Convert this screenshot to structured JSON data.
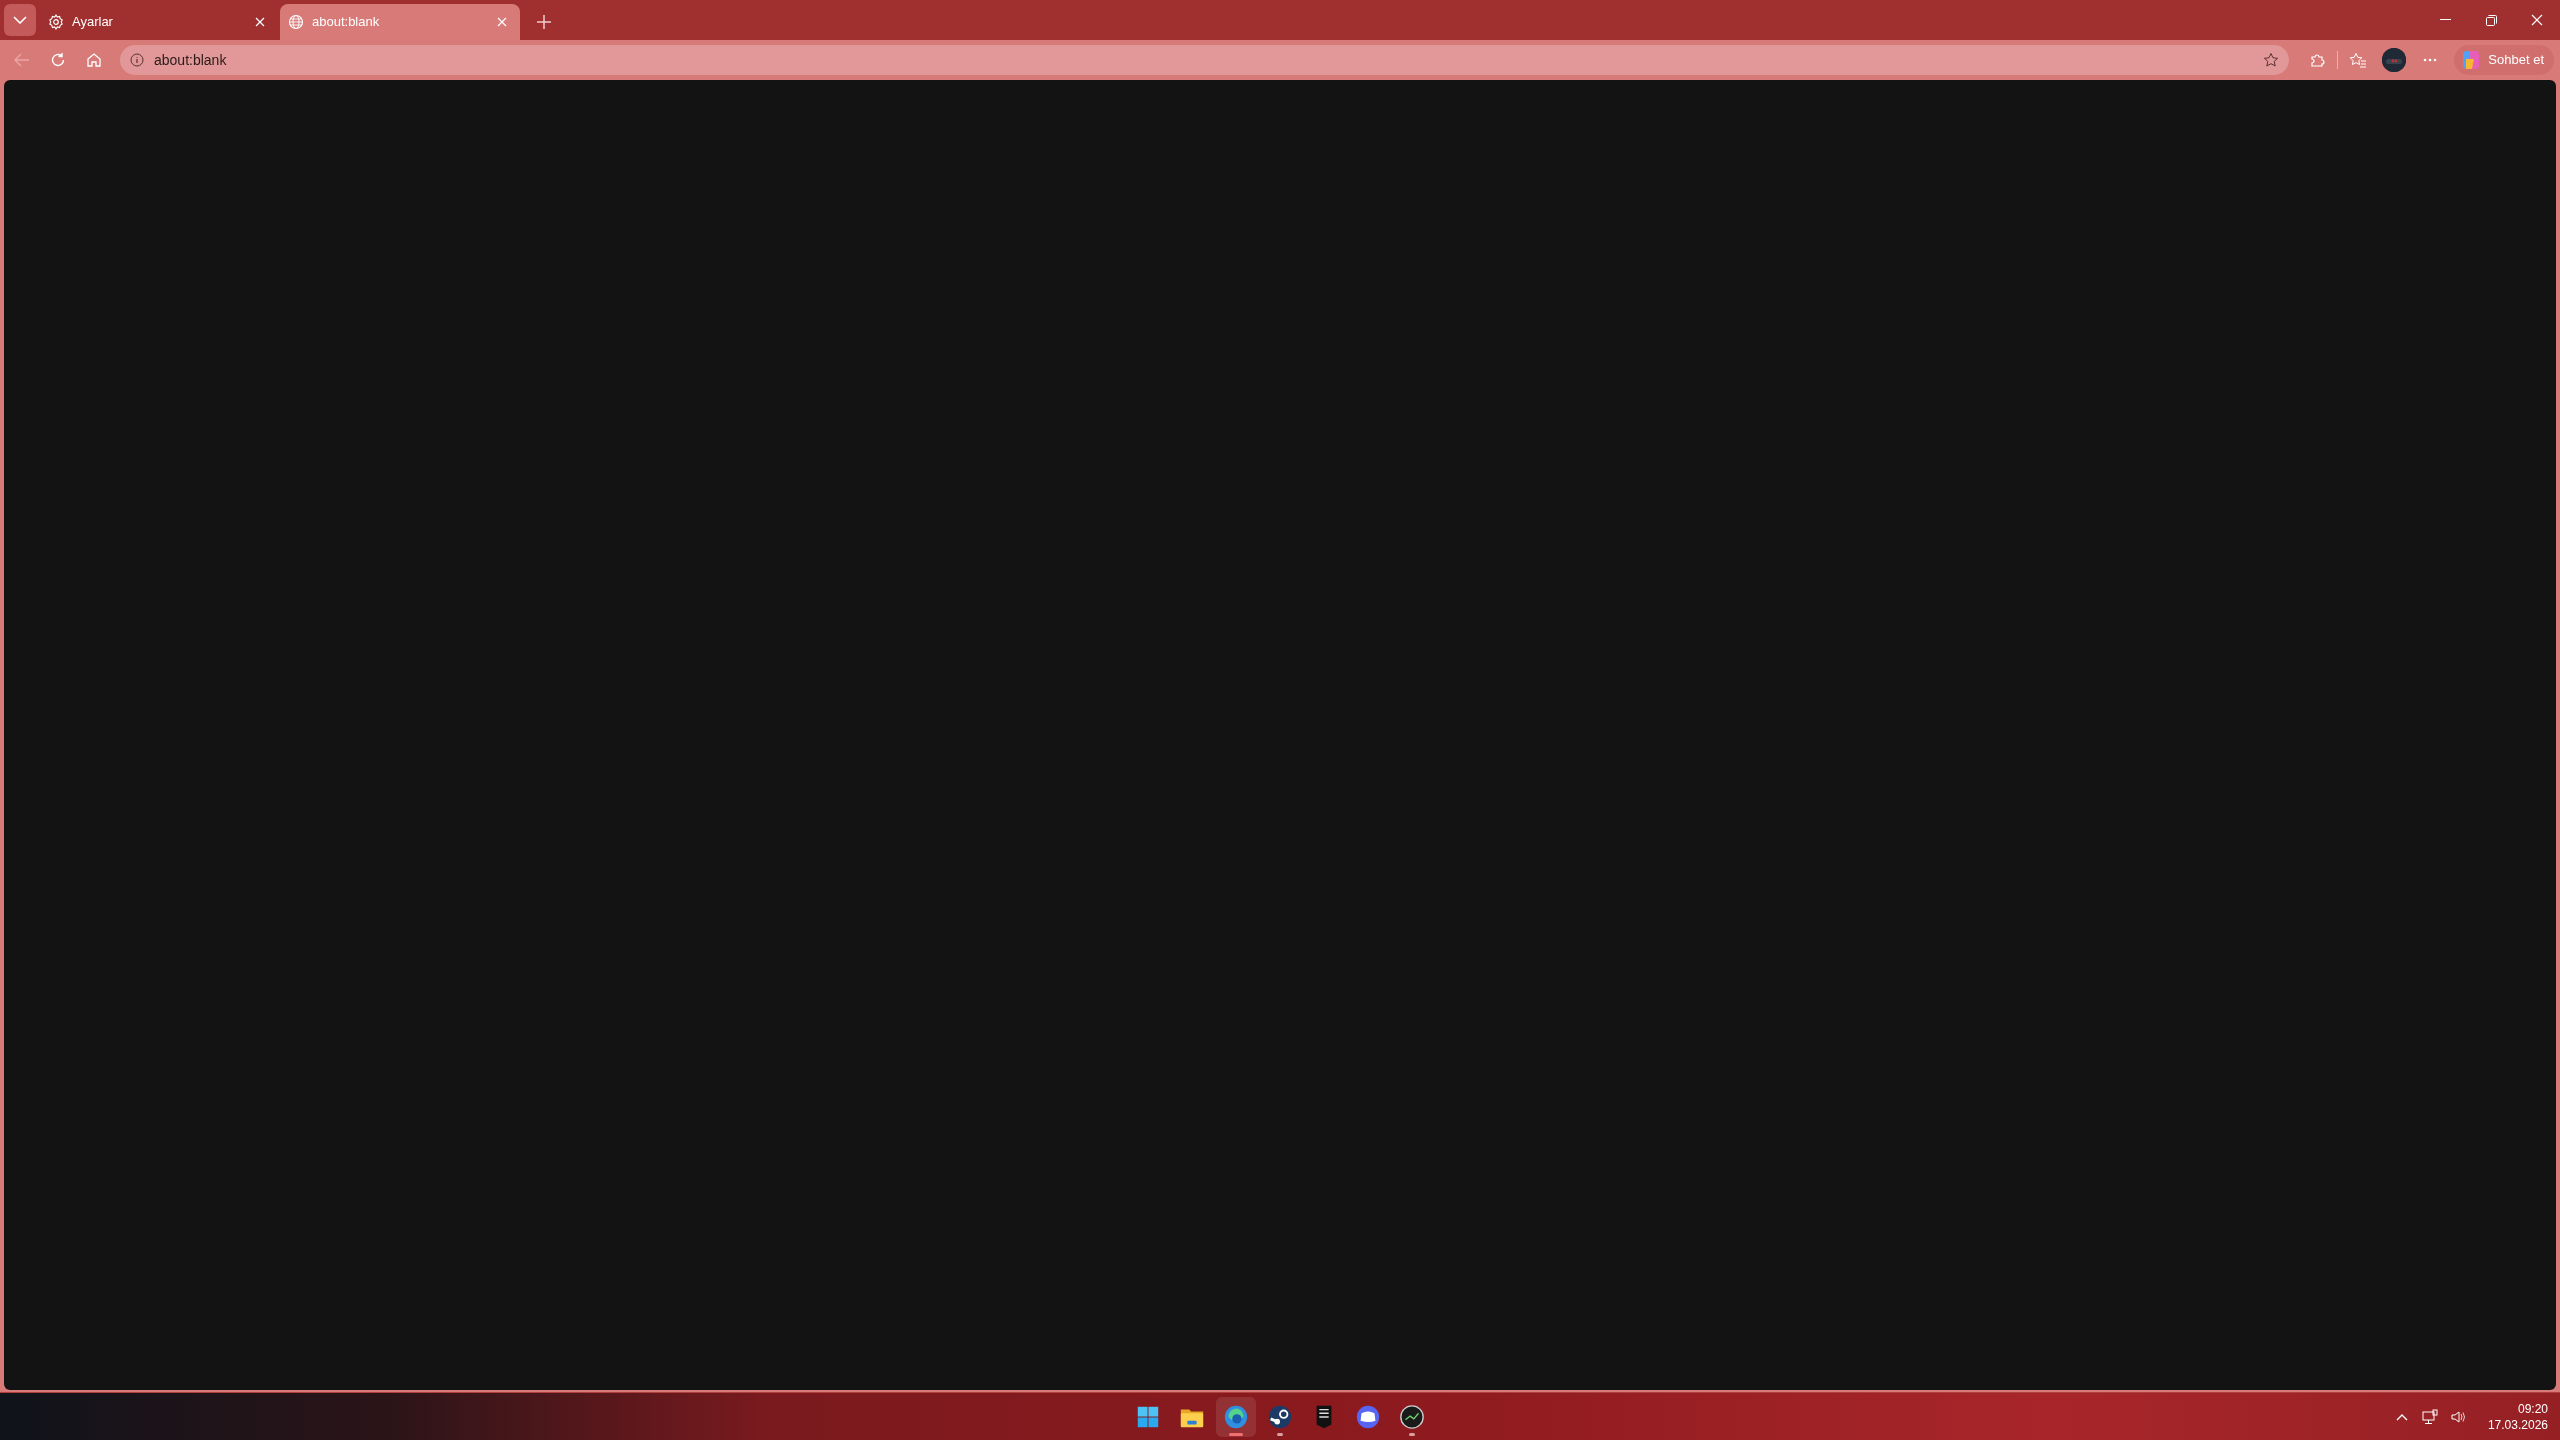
{
  "tabs": [
    {
      "label": "Ayarlar",
      "kind": "settings",
      "selected": false
    },
    {
      "label": "about:blank",
      "kind": "web",
      "selected": true
    }
  ],
  "address_bar": {
    "value": "about:blank"
  },
  "copilot_button": {
    "label": "Sohbet et"
  },
  "taskbar": {
    "apps": [
      {
        "kind": "start",
        "active": false,
        "running": false
      },
      {
        "kind": "folder",
        "active": false,
        "running": false
      },
      {
        "kind": "browser",
        "active": true,
        "running": true
      },
      {
        "kind": "steam",
        "active": false,
        "running": true
      },
      {
        "kind": "shield",
        "active": false,
        "running": false
      },
      {
        "kind": "chat",
        "active": false,
        "running": false
      },
      {
        "kind": "dark",
        "active": false,
        "running": true
      }
    ],
    "time": "09:20",
    "date": "17.03.2026"
  }
}
